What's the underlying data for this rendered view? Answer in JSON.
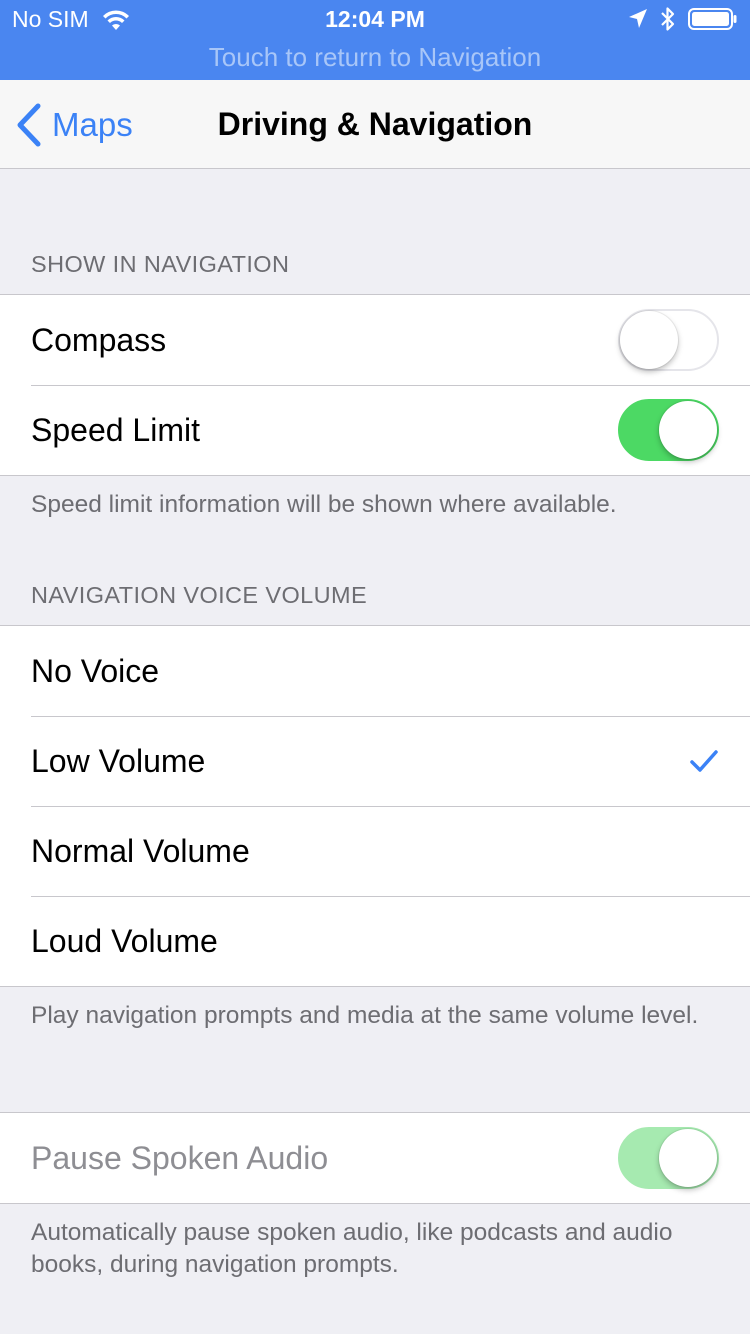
{
  "status_bar": {
    "carrier": "No SIM",
    "time": "12:04 PM",
    "return_banner": "Touch to return to Navigation",
    "icons": [
      "wifi-icon",
      "location-arrow-icon",
      "bluetooth-icon",
      "battery-icon"
    ]
  },
  "navbar": {
    "back_label": "Maps",
    "title": "Driving & Navigation"
  },
  "show_in_navigation": {
    "header": "SHOW IN NAVIGATION",
    "rows": [
      {
        "label": "Compass",
        "toggle": false
      },
      {
        "label": "Speed Limit",
        "toggle": true
      }
    ],
    "footer": "Speed limit information will be shown where available."
  },
  "voice_volume": {
    "header": "NAVIGATION VOICE VOLUME",
    "options": [
      "No Voice",
      "Low Volume",
      "Normal Volume",
      "Loud Volume"
    ],
    "selected": "Low Volume",
    "footer": "Play navigation prompts and media at the same volume level."
  },
  "pause_audio": {
    "label": "Pause Spoken Audio",
    "toggle": true,
    "enabled": false,
    "footer": "Automatically pause spoken audio, like podcasts and audio books, during navigation prompts."
  },
  "colors": {
    "status_bar_bg": "#4a86f0",
    "accent": "#3b82f6",
    "toggle_on": "#4cd964",
    "background": "#efeff4"
  }
}
